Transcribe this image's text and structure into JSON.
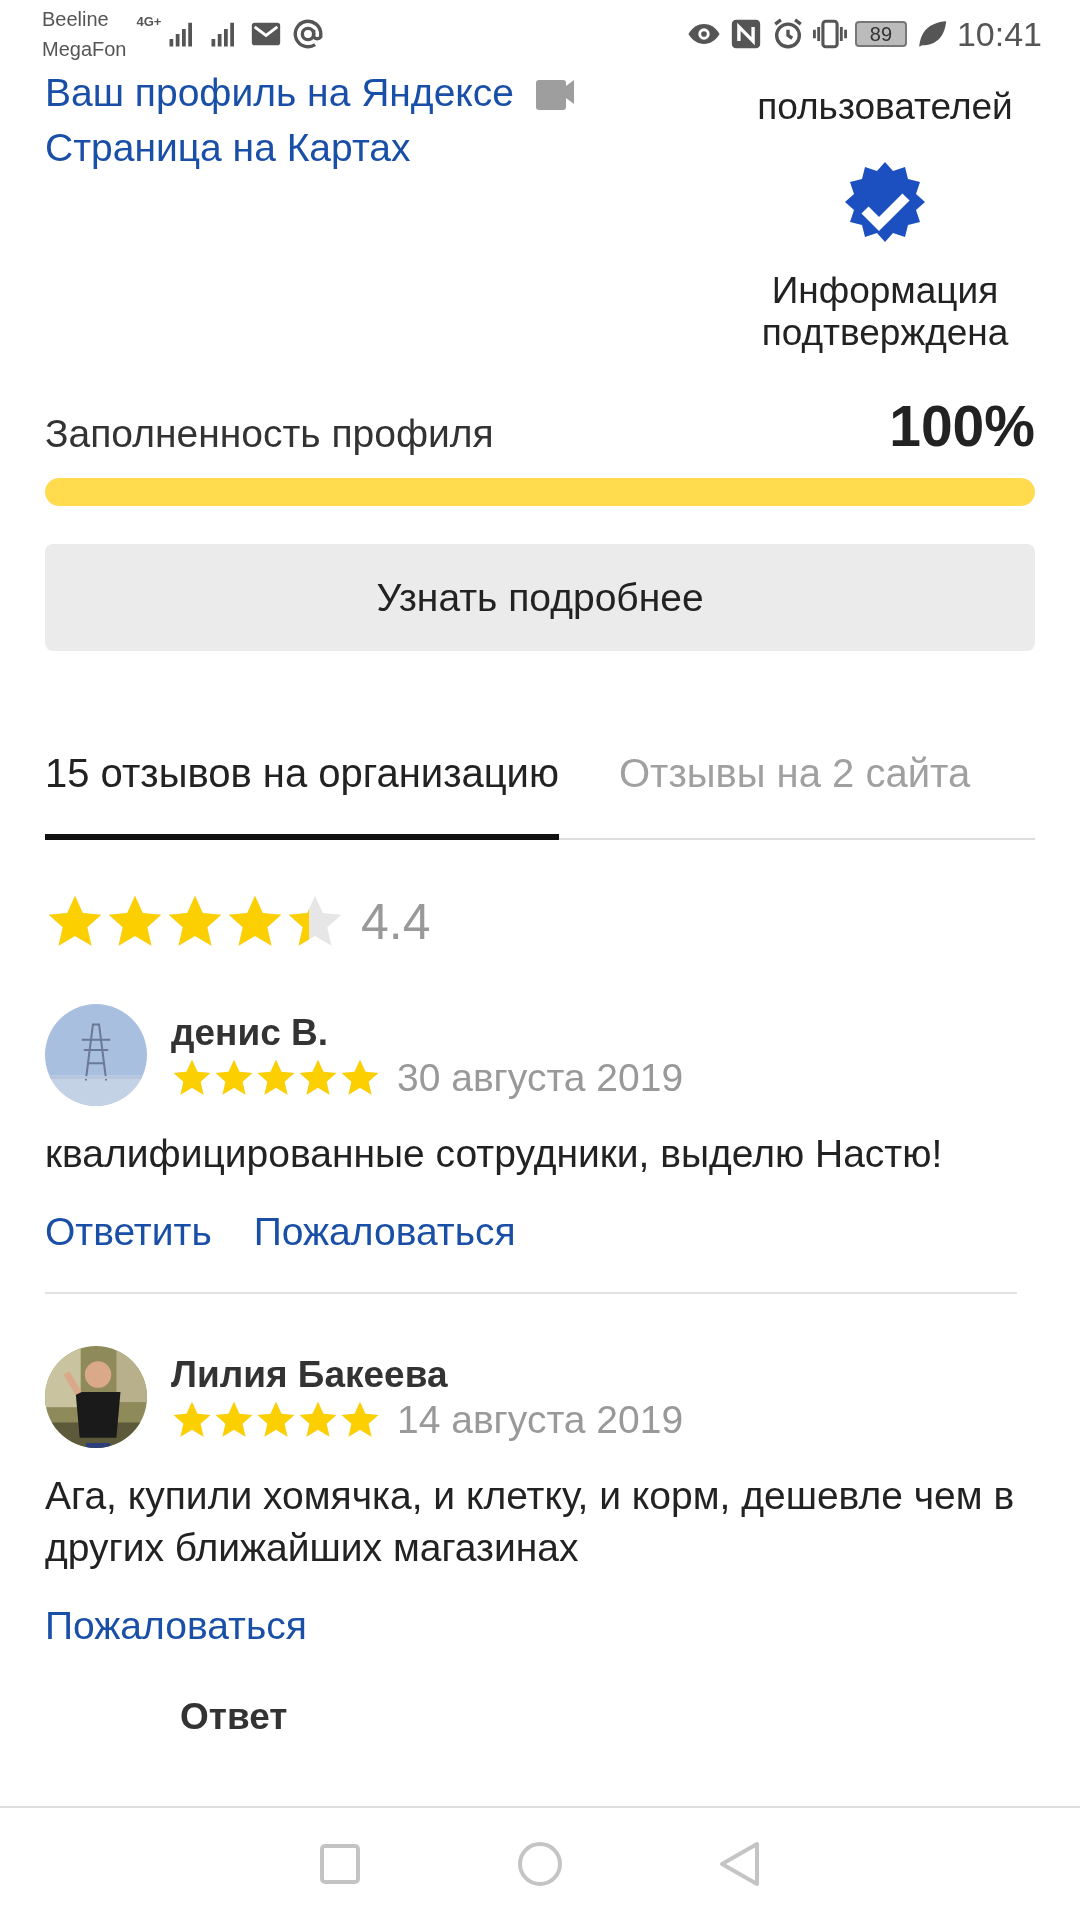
{
  "status_bar": {
    "carriers": [
      "Beeline",
      "MegaFon"
    ],
    "network": "4G+",
    "battery": "89",
    "time": "10:41"
  },
  "profile_links": [
    "Ваш профиль на Яндексе",
    "Страница на Картах"
  ],
  "awards": [
    {
      "kind": "text",
      "lines": [
        "пользователей"
      ]
    },
    {
      "kind": "verified",
      "lines": [
        "Информация",
        "подтверждена"
      ]
    }
  ],
  "profile_fill": {
    "label": "Заполненность профиля",
    "percent": "100%",
    "level": 1.0
  },
  "more_button": "Узнать подробнее",
  "tabs": [
    {
      "label": "15 отзывов на организацию",
      "selected": true
    },
    {
      "label": "Отзывы на 2 сайта",
      "selected": false
    }
  ],
  "rating": {
    "stars": 4.4,
    "value": "4.4"
  },
  "reviews": [
    {
      "author": "денис В.",
      "stars": 5,
      "date": "30 августа 2019",
      "text": "квалифицированные сотрудники, выделю Настю!",
      "avatar": {
        "kind": "picture"
      },
      "actions": [
        "Ответить",
        "Пожаловаться"
      ]
    },
    {
      "author": "Лилия Бакеева",
      "stars": 5,
      "date": "14 августа 2019",
      "text": "Ага, купили хомячка, и клетку, и корм, дешевле чем в других ближайших магазинах",
      "avatar": {
        "kind": "picture"
      },
      "actions": [
        "Пожаловаться"
      ]
    }
  ],
  "reply": {
    "title": "Ответ"
  }
}
